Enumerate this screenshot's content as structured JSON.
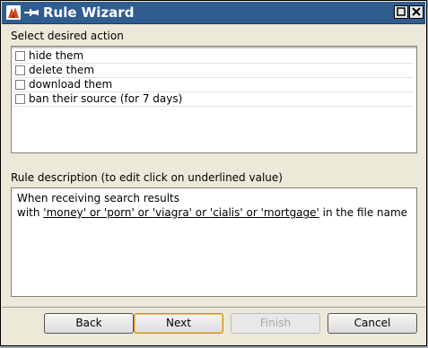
{
  "window": {
    "title": "Rule Wizard",
    "accent": "#2f5d90"
  },
  "actions": {
    "heading": "Select desired action",
    "items": [
      {
        "label": "hide them",
        "checked": false
      },
      {
        "label": "delete them",
        "checked": false
      },
      {
        "label": "download them",
        "checked": false
      },
      {
        "label": "ban their source (for 7 days)",
        "checked": false
      }
    ]
  },
  "description": {
    "heading": "Rule description (to edit click on underlined value)",
    "line1": "When receiving search results",
    "line2_prefix": "with ",
    "line2_link": "'money' or 'porn' or 'viagra' or 'cialis' or 'mortgage'",
    "line2_suffix": " in the file name"
  },
  "buttons": {
    "back": "Back",
    "next": "Next",
    "finish": "Finish",
    "cancel": "Cancel"
  },
  "icons": {
    "app": "app-logo-icon",
    "pin": "pin-icon",
    "maximize": "maximize-icon",
    "close": "close-icon"
  }
}
